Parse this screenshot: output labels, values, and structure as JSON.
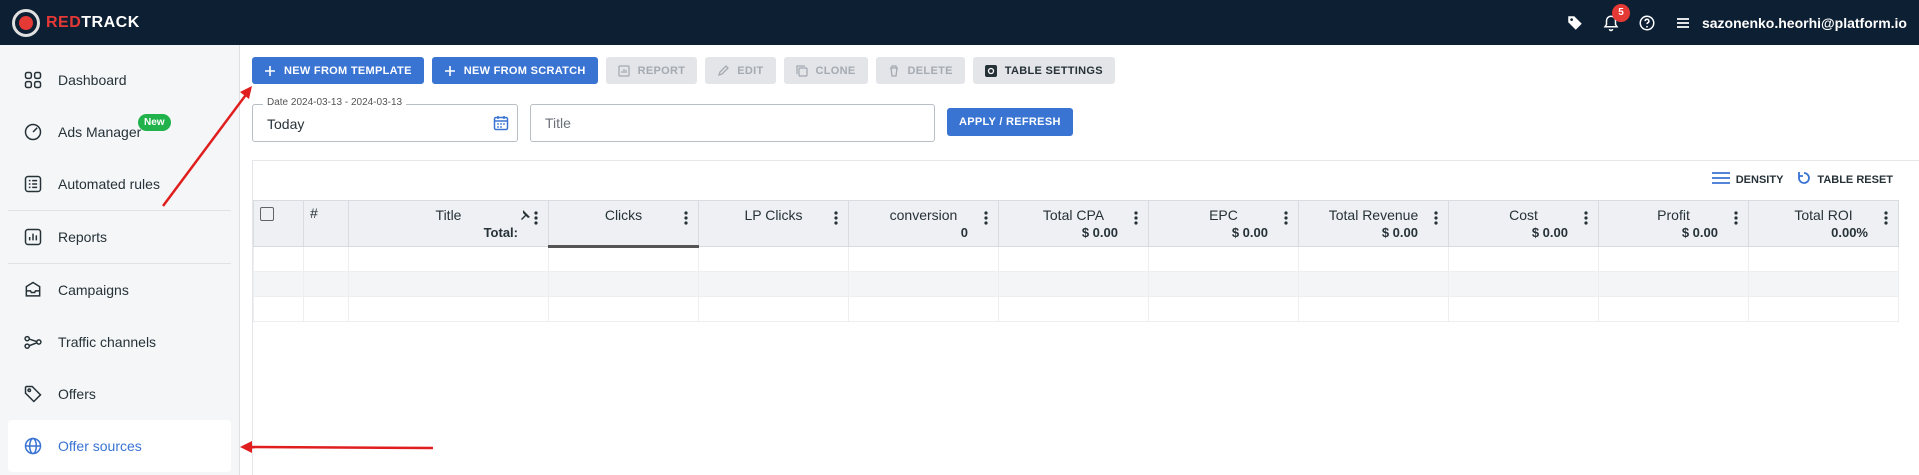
{
  "brand": {
    "prefix": "RED",
    "suffix": "TRACK"
  },
  "header": {
    "notification_count": "5",
    "user_email": "sazonenko.heorhi@platform.io"
  },
  "sidebar": {
    "items": [
      {
        "label": "Dashboard",
        "icon": "grid-icon"
      },
      {
        "label": "Ads Manager",
        "icon": "gauge-icon",
        "badge": "New"
      },
      {
        "label": "Automated rules",
        "icon": "list-icon"
      },
      {
        "label": "Reports",
        "icon": "bar-chart-icon"
      },
      {
        "label": "Campaigns",
        "icon": "inbox-icon"
      },
      {
        "label": "Traffic channels",
        "icon": "share-nodes-icon"
      },
      {
        "label": "Offers",
        "icon": "tag-icon"
      },
      {
        "label": "Offer sources",
        "icon": "globe-icon"
      }
    ]
  },
  "toolbar": {
    "new_from_template": "NEW FROM TEMPLATE",
    "new_from_scratch": "NEW FROM SCRATCH",
    "report": "REPORT",
    "edit": "EDIT",
    "clone": "CLONE",
    "delete": "DELETE",
    "table_settings": "TABLE SETTINGS"
  },
  "filters": {
    "date_label": "Date 2024-03-13 - 2024-03-13",
    "date_value": "Today",
    "title_placeholder": "Title",
    "apply_label": "APPLY / REFRESH"
  },
  "table_actions": {
    "density": "DENSITY",
    "table_reset": "TABLE RESET"
  },
  "table": {
    "columns": [
      {
        "name": "#",
        "total": ""
      },
      {
        "name": "Title",
        "total": "Total:"
      },
      {
        "name": "Clicks",
        "total": ""
      },
      {
        "name": "LP Clicks",
        "total": ""
      },
      {
        "name": "conversion",
        "total": "0"
      },
      {
        "name": "Total CPA",
        "total": "$ 0.00"
      },
      {
        "name": "EPC",
        "total": "$ 0.00"
      },
      {
        "name": "Total Revenue",
        "total": "$ 0.00"
      },
      {
        "name": "Cost",
        "total": "$ 0.00"
      },
      {
        "name": "Profit",
        "total": "$ 0.00"
      },
      {
        "name": "Total ROI",
        "total": "0.00%"
      }
    ]
  },
  "colors": {
    "accent": "#3a74d3",
    "topbar": "#0d1f33",
    "brand_red": "#e53935",
    "badge_green": "#21b24b"
  }
}
